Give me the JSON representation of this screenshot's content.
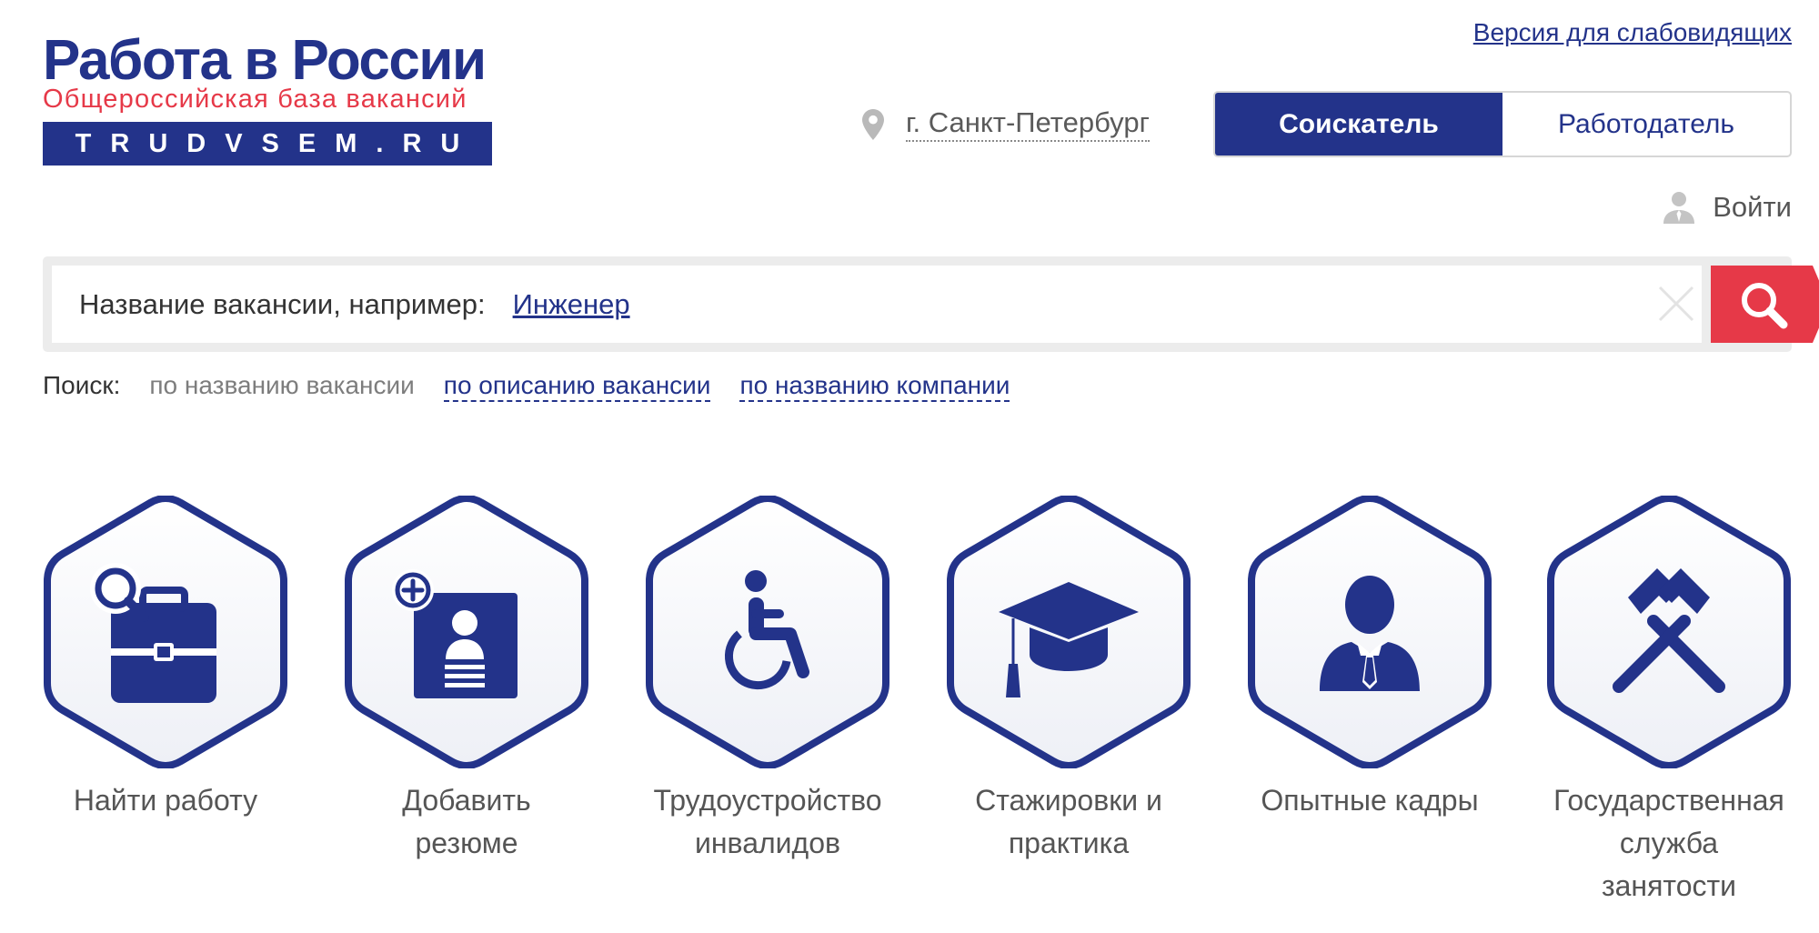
{
  "header": {
    "logo_title": "Работа в России",
    "logo_subtitle": "Общероссийская база вакансий",
    "logo_domain": "TRUDVSEM.RU",
    "accessibility_link": "Версия для слабовидящих",
    "city": "г. Санкт-Петербург",
    "roles": [
      {
        "label": "Соискатель",
        "active": true
      },
      {
        "label": "Работодатель",
        "active": false
      }
    ],
    "login": "Войти"
  },
  "search": {
    "label": "Название вакансии, например:",
    "example": "Инженер",
    "modes_label": "Поиск:",
    "modes": [
      {
        "label": "по названию вакансии",
        "active": true
      },
      {
        "label": "по описанию вакансии",
        "active": false
      },
      {
        "label": "по названию компании",
        "active": false
      }
    ]
  },
  "tiles": [
    {
      "label_lines": [
        "Найти работу"
      ],
      "icon": "briefcase-search-icon"
    },
    {
      "label_lines": [
        "Добавить",
        "резюме"
      ],
      "icon": "add-resume-icon"
    },
    {
      "label_lines": [
        "Трудоустройство",
        "инвалидов"
      ],
      "icon": "wheelchair-icon"
    },
    {
      "label_lines": [
        "Стажировки и",
        "практика"
      ],
      "icon": "graduation-cap-icon"
    },
    {
      "label_lines": [
        "Опытные кадры"
      ],
      "icon": "businessman-icon"
    },
    {
      "label_lines": [
        "Государственная",
        "служба",
        "занятости"
      ],
      "icon": "hammers-icon"
    }
  ],
  "colors": {
    "brand_blue": "#23338a",
    "brand_red": "#e63948",
    "text_gray": "#555555"
  }
}
